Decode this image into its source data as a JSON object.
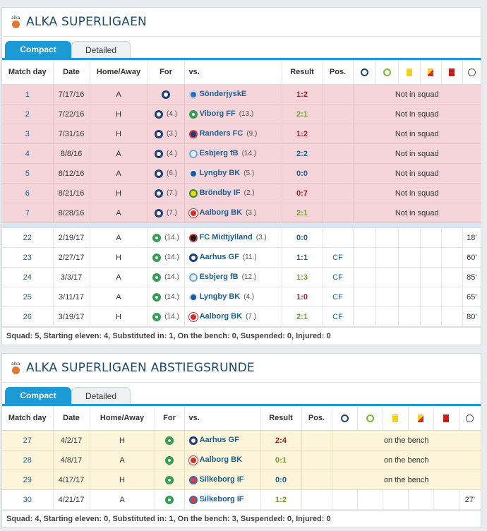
{
  "columns": {
    "matchday": "Match day",
    "date": "Date",
    "homeaway": "Home/Away",
    "for": "For",
    "vs": "vs.",
    "result": "Result",
    "pos": "Pos.",
    "icons": [
      "goal-ball-icon",
      "assist-ball-icon",
      "yellow-card-icon",
      "yellow-red-card-icon",
      "red-card-icon",
      "clock-icon"
    ]
  },
  "tabs": {
    "compact": "Compact",
    "detailed": "Detailed"
  },
  "colors": {
    "accent": "#1c9ad6",
    "title": "#1c4a6b",
    "win": "#6d9e1e",
    "draw": "#1c5f93",
    "loss": "#9e1f1f"
  },
  "section1": {
    "title": "ALKA SUPERLIGAEN",
    "logo_text": "alka",
    "rows_red": [
      {
        "md": "1",
        "date": "7/17/16",
        "ha": "A",
        "for_rank": "",
        "opp": "SönderjyskE",
        "opp_rank": "",
        "res": "1:2",
        "res_class": "loss",
        "note": "Not in squad",
        "crest": "c-son"
      },
      {
        "md": "2",
        "date": "7/22/16",
        "ha": "H",
        "for_rank": "(4.)",
        "opp": "Viborg FF",
        "opp_rank": "(13.)",
        "res": "2:1",
        "res_class": "win",
        "note": "Not in squad",
        "crest": "c-vib"
      },
      {
        "md": "3",
        "date": "7/31/16",
        "ha": "H",
        "for_rank": "(3.)",
        "opp": "Randers FC",
        "opp_rank": "(9.)",
        "res": "1:2",
        "res_class": "loss",
        "note": "Not in squad",
        "crest": "c-ran"
      },
      {
        "md": "4",
        "date": "8/8/16",
        "ha": "A",
        "for_rank": "(4.)",
        "opp": "Esbjerg fB",
        "opp_rank": "(14.)",
        "res": "2:2",
        "res_class": "draw",
        "note": "Not in squad",
        "crest": "c-esb"
      },
      {
        "md": "5",
        "date": "8/12/16",
        "ha": "A",
        "for_rank": "(6.)",
        "opp": "Lyngby BK",
        "opp_rank": "(5.)",
        "res": "0:0",
        "res_class": "draw",
        "note": "Not in squad",
        "crest": "c-lyn"
      },
      {
        "md": "6",
        "date": "8/21/16",
        "ha": "H",
        "for_rank": "(7.)",
        "opp": "Bröndby IF",
        "opp_rank": "(2.)",
        "res": "0:7",
        "res_class": "loss",
        "note": "Not in squad",
        "crest": "c-bro"
      },
      {
        "md": "7",
        "date": "8/28/16",
        "ha": "A",
        "for_rank": "(7.)",
        "opp": "Aalborg BK",
        "opp_rank": "(3.)",
        "res": "2:1",
        "res_class": "win",
        "note": "Not in squad",
        "crest": "c-aab"
      }
    ],
    "rows_white": [
      {
        "md": "22",
        "date": "2/19/17",
        "ha": "A",
        "for_rank": "(14.)",
        "opp": "FC Midtjylland",
        "opp_rank": "(3.)",
        "res": "0:0",
        "res_class": "draw",
        "pos": "",
        "min": "18'",
        "crest": "c-fcm"
      },
      {
        "md": "23",
        "date": "2/27/17",
        "ha": "H",
        "for_rank": "(14.)",
        "opp": "Aarhus GF",
        "opp_rank": "(11.)",
        "res": "1:1",
        "res_class": "draw",
        "pos": "CF",
        "min": "60'",
        "crest": "c-agf"
      },
      {
        "md": "24",
        "date": "3/3/17",
        "ha": "A",
        "for_rank": "(14.)",
        "opp": "Esbjerg fB",
        "opp_rank": "(12.)",
        "res": "1:3",
        "res_class": "win",
        "pos": "CF",
        "min": "85'",
        "crest": "c-esb"
      },
      {
        "md": "25",
        "date": "3/11/17",
        "ha": "A",
        "for_rank": "(14.)",
        "opp": "Lyngby BK",
        "opp_rank": "(4.)",
        "res": "1:0",
        "res_class": "loss",
        "pos": "CF",
        "min": "65'",
        "crest": "c-lyn"
      },
      {
        "md": "26",
        "date": "3/19/17",
        "ha": "H",
        "for_rank": "(14.)",
        "opp": "Aalborg BK",
        "opp_rank": "(7.)",
        "res": "2:1",
        "res_class": "win",
        "pos": "CF",
        "min": "80'",
        "crest": "c-aab"
      }
    ],
    "summary": "Squad: 5, Starting eleven: 4, Substituted in: 1, On the bench: 0, Suspended: 0, Injured: 0"
  },
  "section2": {
    "title": "ALKA SUPERLIGAEN ABSTIEGSRUNDE",
    "logo_text": "alka",
    "rows_yellow": [
      {
        "md": "27",
        "date": "4/2/17",
        "ha": "H",
        "opp": "Aarhus GF",
        "res": "2:4",
        "res_class": "loss",
        "note": "on the bench",
        "crest": "c-agf"
      },
      {
        "md": "28",
        "date": "4/8/17",
        "ha": "A",
        "opp": "Aalborg BK",
        "res": "0:1",
        "res_class": "win",
        "note": "on the bench",
        "crest": "c-aab"
      },
      {
        "md": "29",
        "date": "4/17/17",
        "ha": "H",
        "opp": "Silkeborg IF",
        "res": "0:0",
        "res_class": "draw",
        "note": "on the bench",
        "crest": "c-sil"
      }
    ],
    "rows_white": [
      {
        "md": "30",
        "date": "4/21/17",
        "ha": "A",
        "opp": "Silkeborg IF",
        "res": "1:2",
        "res_class": "win",
        "pos": "",
        "min": "27'",
        "crest": "c-sil"
      }
    ],
    "summary": "Squad: 4, Starting eleven: 0, Substituted in: 1, On the bench: 3, Suspended: 0, Injured: 0"
  }
}
